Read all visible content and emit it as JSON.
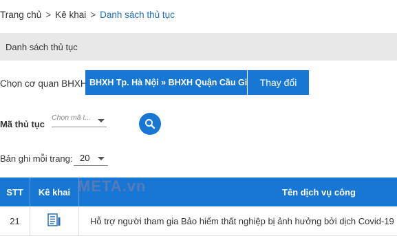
{
  "breadcrumb": {
    "items": [
      "Trang chủ",
      "Kê khai",
      "Danh sách thủ tục"
    ],
    "separator": ">"
  },
  "section": {
    "title": "Danh sách thủ tục"
  },
  "agency": {
    "label": "Chọn cơ quan BHXH:",
    "selected": "BHXH Tp. Hà Nội » BHXH Quận Cầu Giấy",
    "change_button": "Thay đổi"
  },
  "procedure": {
    "label": "Mã thủ tục",
    "placeholder": "Chọn mã t..."
  },
  "per_page": {
    "label": "Bản ghi mỗi trang:",
    "value": "20"
  },
  "watermark": "META.vn",
  "table": {
    "columns": [
      "STT",
      "Kê khai",
      "Tên dịch vụ công"
    ],
    "rows": [
      {
        "stt": "21",
        "name": "Hỗ trợ người tham gia Bảo hiểm thất nghiệp bị ảnh hưởng bởi dịch Covid-19"
      }
    ]
  },
  "colors": {
    "primary": "#1877d2",
    "section_bg": "#e8e8e8",
    "link": "#1f6fc2"
  }
}
